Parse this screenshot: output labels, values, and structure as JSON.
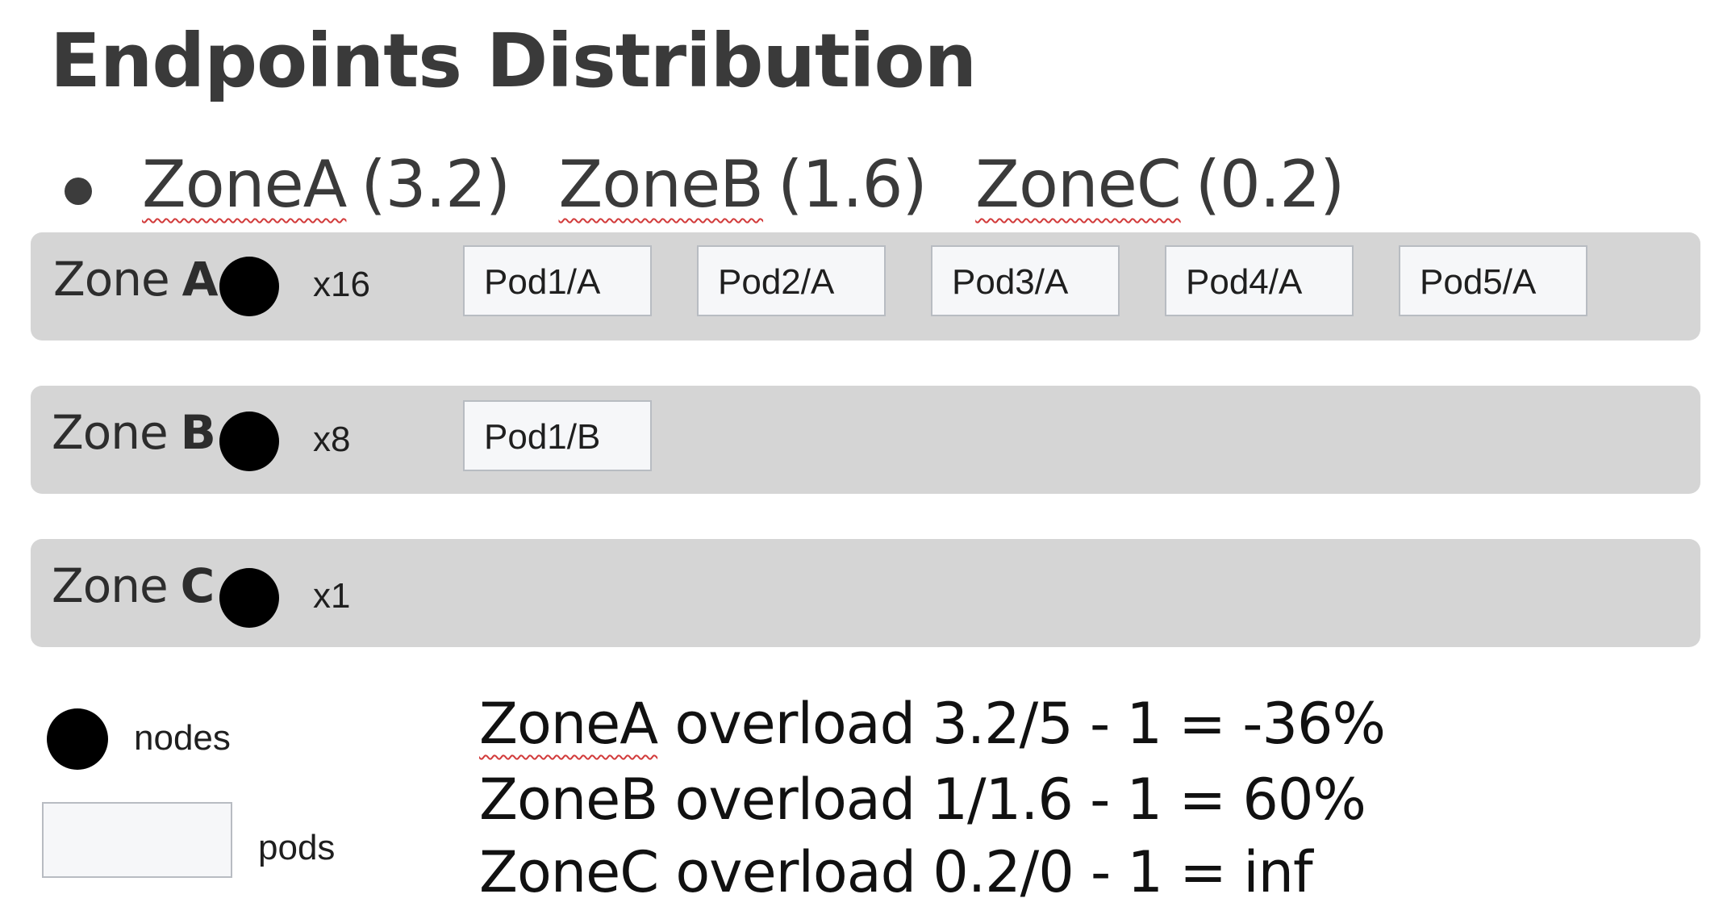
{
  "title": "Endpoints Distribution",
  "weights": [
    {
      "zone": "ZoneA",
      "value": "(3.2)"
    },
    {
      "zone": "ZoneB",
      "value": "(1.6)"
    },
    {
      "zone": "ZoneC",
      "value": "(0.2)"
    }
  ],
  "zones": [
    {
      "prefix": "Zone",
      "letter": "A",
      "count": "x16",
      "pods": [
        "Pod1/A",
        "Pod2/A",
        "Pod3/A",
        "Pod4/A",
        "Pod5/A"
      ]
    },
    {
      "prefix": "Zone",
      "letter": "B",
      "count": "x8",
      "pods": [
        "Pod1/B"
      ]
    },
    {
      "prefix": "Zone",
      "letter": "C",
      "count": "x1",
      "pods": []
    }
  ],
  "legend": {
    "nodes_label": "nodes",
    "pods_label": "pods"
  },
  "calculations": [
    {
      "zone": "ZoneA",
      "text": " overload 3.2/5 - 1 = -36%"
    },
    {
      "zone": "ZoneB",
      "text": " overload 1/1.6 - 1 = 60%"
    },
    {
      "zone": "ZoneC",
      "text": " overload 0.2/0 - 1 = inf"
    }
  ],
  "colors": {
    "zone_bar": "#d5d5d5",
    "pod_fill": "#f6f7f9",
    "pod_border": "#b8bcc2",
    "node": "#000000",
    "spellcheck_underline": "#d23b3b"
  }
}
